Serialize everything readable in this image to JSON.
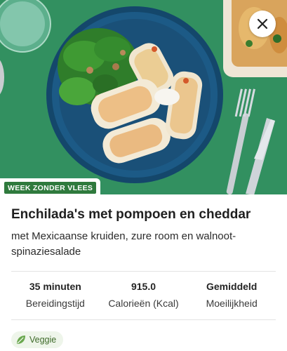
{
  "recipe": {
    "tag": "WEEK ZONDER VLEES",
    "title": "Enchilada's met pompoen en cheddar",
    "subtitle": "met Mexicaanse kruiden, zure room en walnoot-spinaziesalade"
  },
  "stats": [
    {
      "value": "35 minuten",
      "label": "Bereidingstijd"
    },
    {
      "value": "915.0",
      "label": "Calorieën (Kcal)"
    },
    {
      "value": "Gemiddeld",
      "label": "Moeilijkheid"
    }
  ],
  "chips": [
    {
      "label": "Veggie",
      "icon": "leaf-icon"
    }
  ],
  "icons": {
    "close": "close-icon",
    "veggie": "leaf-icon"
  },
  "colors": {
    "tag_bg": "#2f7a3d",
    "chip_bg": "#eef5ea",
    "chip_icon": "#6aa84f",
    "hero_bg": "#2f8a5c"
  }
}
